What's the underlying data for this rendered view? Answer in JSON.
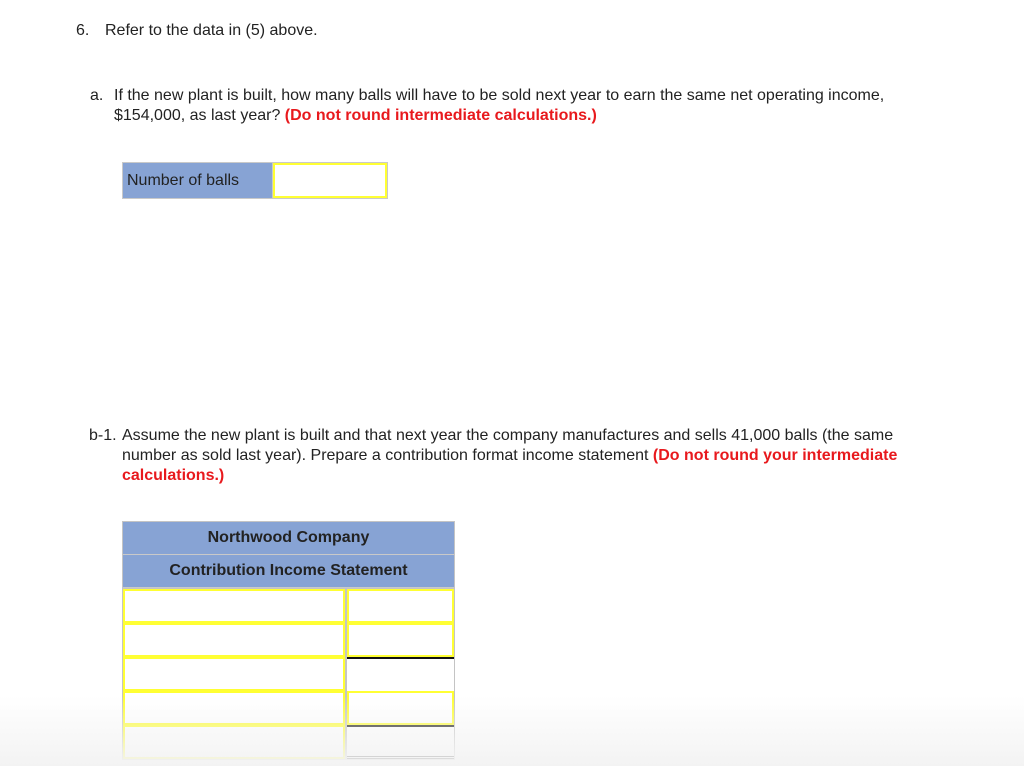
{
  "question": {
    "number": "6.",
    "title": "Refer to the data in (5) above."
  },
  "part_a": {
    "label": "a.",
    "text": "If the new plant is built, how many balls will have to be sold next year to earn the same net operating income, $154,000, as last year?",
    "note": "(Do not round intermediate calculations.)",
    "input_label": "Number of balls",
    "input_value": ""
  },
  "part_b1": {
    "label": "b-1.",
    "text": "Assume the new plant is built and that next year the company manufactures and sells 41,000 balls (the same number as sold last year). Prepare a contribution format income statement",
    "note": "(Do not round your intermediate calculations.)"
  },
  "statement": {
    "company": "Northwood Company",
    "title": "Contribution Income Statement",
    "rows": [
      {
        "label": "",
        "value": "",
        "value_type": "input"
      },
      {
        "label": "",
        "value": "",
        "value_type": "input"
      },
      {
        "label": "",
        "value": "",
        "value_type": "calculated"
      },
      {
        "label": "",
        "value": "",
        "value_type": "input"
      },
      {
        "label": "",
        "value": "",
        "value_type": "calculated-total"
      }
    ]
  },
  "colors": {
    "header_blue": "#87a3d4",
    "input_border_yellow": "#ffff33",
    "note_red": "#e8191d"
  }
}
